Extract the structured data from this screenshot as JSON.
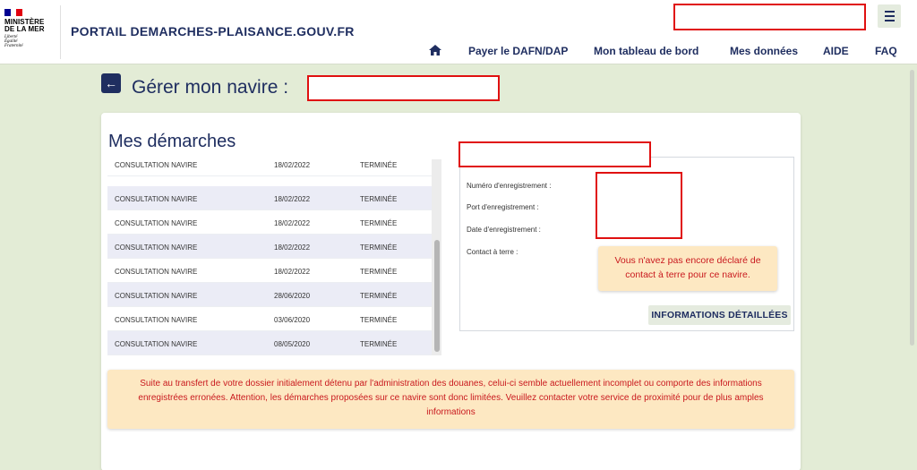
{
  "header": {
    "logo": {
      "line1": "MINISTÈRE",
      "line2": "DE LA MER",
      "motto": [
        "Liberté",
        "Égalité",
        "Fraternité"
      ],
      "flag_colors": [
        "#000091",
        "#ffffff",
        "#e1000f"
      ]
    },
    "portal_title": "PORTAIL DEMARCHES-PLAISANCE.GOUV.FR",
    "menu_icon": "hamburger-menu-icon",
    "home_icon": "home-icon",
    "nav": [
      "Payer le DAFN/DAP",
      "Mon tableau de bord",
      "Mes données",
      "AIDE",
      "FAQ"
    ]
  },
  "page": {
    "title": "Gérer mon navire : ",
    "back_icon": "back-arrow-icon"
  },
  "card": {
    "title": "Mes démarches",
    "rows": [
      {
        "type": "CONSULTATION NAVIRE",
        "date": "18/02/2022",
        "status": "TERMINÉE"
      },
      {
        "type": "CONSULTATION NAVIRE",
        "date": "18/02/2022",
        "status": "TERMINÉE"
      },
      {
        "type": "CONSULTATION NAVIRE",
        "date": "18/02/2022",
        "status": "TERMINÉE"
      },
      {
        "type": "CONSULTATION NAVIRE",
        "date": "18/02/2022",
        "status": "TERMINÉE"
      },
      {
        "type": "CONSULTATION NAVIRE",
        "date": "18/02/2022",
        "status": "TERMINÉE"
      },
      {
        "type": "CONSULTATION NAVIRE",
        "date": "28/06/2020",
        "status": "TERMINÉE"
      },
      {
        "type": "CONSULTATION NAVIRE",
        "date": "03/06/2020",
        "status": "TERMINÉE"
      },
      {
        "type": "CONSULTATION NAVIRE",
        "date": "08/05/2020",
        "status": "TERMINÉE"
      }
    ],
    "details": {
      "labels": {
        "numero": "Numéro d'enregistrement :",
        "port": "Port d'enregistrement :",
        "date": "Date d'enregistrement :",
        "contact": "Contact à terre :"
      },
      "contact_tip": "Vous n'avez pas encore déclaré de contact à terre pour ce navire.",
      "info_button": "INFORMATIONS DÉTAILLÉES"
    },
    "alert": "Suite au transfert de votre dossier initialement détenu par l'administration des douanes, celui-ci semble actuellement incomplet ou comporte des informations enregistrées erronées. Attention, les démarches proposées sur ce navire sont donc limitées. Veuillez contacter votre service de proximité pour de plus amples informations"
  },
  "colors": {
    "primary": "#1f2e60",
    "background": "#e3ecd6",
    "alert_bg": "#fde8c2",
    "alert_text": "#c9191e",
    "redaction_border": "#e01010",
    "row_alt": "#ebecf6"
  }
}
